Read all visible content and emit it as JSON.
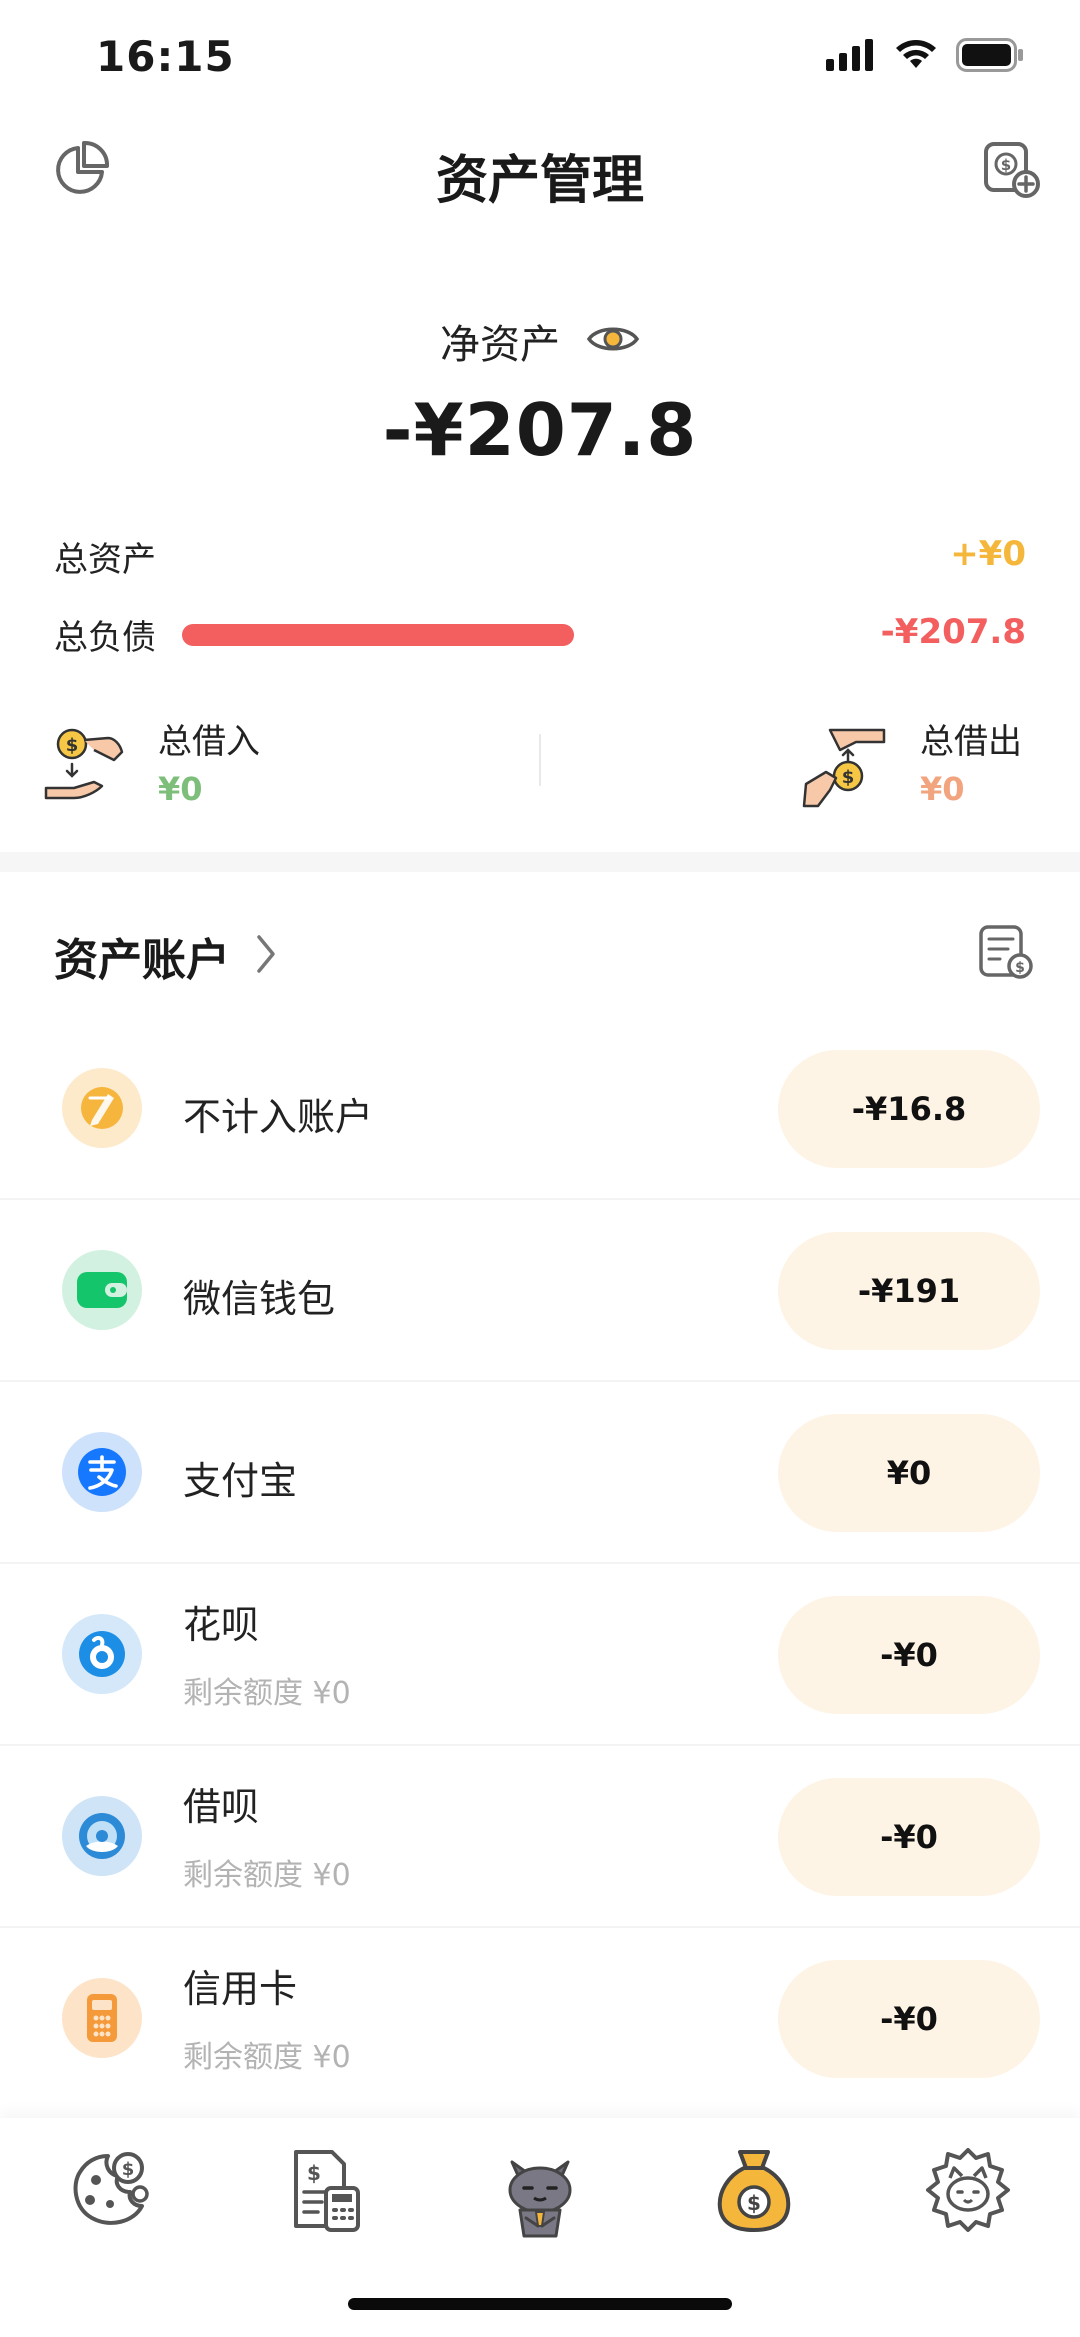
{
  "status_bar": {
    "time": "16:15"
  },
  "header": {
    "title": "资产管理"
  },
  "net_assets": {
    "label": "净资产",
    "value": "-¥207.8"
  },
  "summary": {
    "total_assets_label": "总资产",
    "total_assets_value": "+¥0",
    "total_debt_label": "总负债",
    "total_debt_value": "-¥207.8"
  },
  "loans": {
    "borrowed_label": "总借入",
    "borrowed_value": "¥0",
    "lent_label": "总借出",
    "lent_value": "¥0"
  },
  "accounts_section": {
    "title": "资产账户"
  },
  "accounts": [
    {
      "name": "不计入账户",
      "sub": "",
      "amount": "-¥16.8",
      "icon": "pen-icon"
    },
    {
      "name": "微信钱包",
      "sub": "",
      "amount": "-¥191",
      "icon": "wallet-icon"
    },
    {
      "name": "支付宝",
      "sub": "",
      "amount": "¥0",
      "icon": "alipay-icon"
    },
    {
      "name": "花呗",
      "sub": "剩余额度 ¥0",
      "amount": "-¥0",
      "icon": "huabei-icon"
    },
    {
      "name": "借呗",
      "sub": "剩余额度 ¥0",
      "amount": "-¥0",
      "icon": "jiebei-icon"
    },
    {
      "name": "信用卡",
      "sub": "剩余额度 ¥0",
      "amount": "-¥0",
      "icon": "credit-card-icon"
    }
  ],
  "colors": {
    "accent_yellow": "#f4b73c",
    "debt_red": "#f35f5f",
    "loan_green": "#7dbf7a",
    "loan_orange": "#f1a47d",
    "pill_bg": "#fef4e6",
    "wechat_green": "#14c56b",
    "alipay_blue": "#1677ff"
  },
  "tabs": [
    {
      "name": "tab-overview",
      "icon": "cookie-coin-icon"
    },
    {
      "name": "tab-bills",
      "icon": "invoice-calculator-icon"
    },
    {
      "name": "tab-cat",
      "icon": "cat-mascot-icon"
    },
    {
      "name": "tab-assets",
      "icon": "money-bag-icon"
    },
    {
      "name": "tab-profile",
      "icon": "cat-face-icon"
    }
  ]
}
